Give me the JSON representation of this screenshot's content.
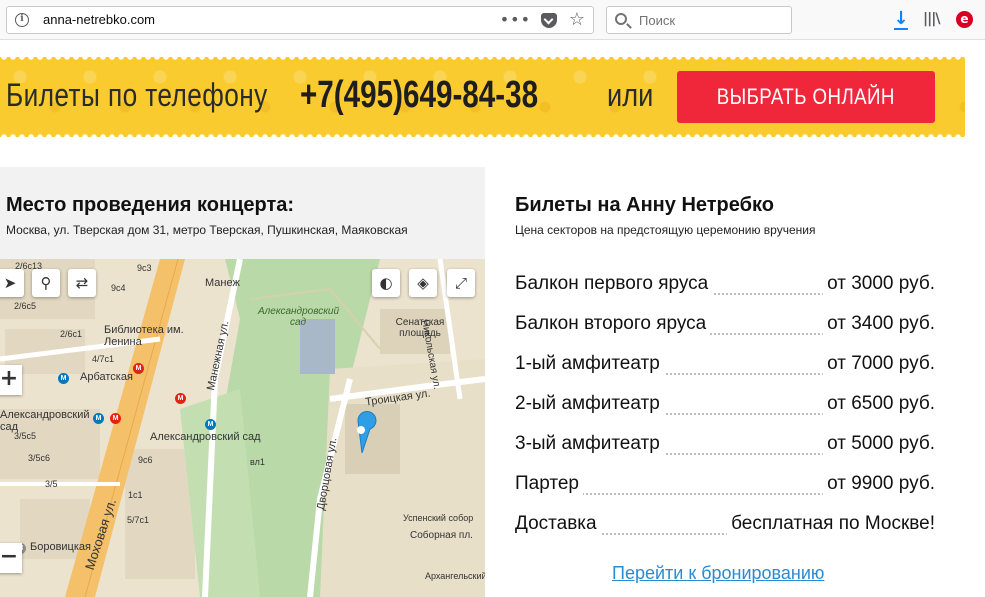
{
  "browser": {
    "url": "anna-netrebko.com",
    "search_placeholder": "Поиск"
  },
  "banner": {
    "phone_label": "Билеты по телефону",
    "phone_number": "+7(495)649-84-38",
    "or": "или",
    "cta": "ВЫБРАТЬ ОНЛАЙН"
  },
  "venue": {
    "title": "Место проведения концерта:",
    "address": "Москва, ул. Тверская дом 31, метро Тверская, Пушкинская, Маяковская",
    "map_labels": {
      "manezh": "Манеж",
      "alexandrovsky_garden_top": "Александровский сад",
      "senate_square": "Сенатская площадь",
      "nikolskaya": "Никольская ул.",
      "library": "Библиотека им. Ленина",
      "arbatskaya": "Арбатская",
      "alexandrovsky_garden_metro": "Александровский сад",
      "alexandrovsky_garden_left": "Александровский сад",
      "troitskaya": "Троицкая ул.",
      "manezhnaya": "Манежная ул.",
      "dvortsovaya": "Дворцовая ул.",
      "mokhovaya": "Моховая ул.",
      "borovitskaya": "Боровицкая",
      "uspensky": "Успенский собор",
      "sobornaya": "Соборная пл.",
      "arkhangelsky": "Архангельский",
      "b1": "2/6c13",
      "b2": "9c3",
      "b3": "2/6c5",
      "b4": "9c4",
      "b5": "2/6c1",
      "b6": "4/7c1",
      "b7": "3/5c5",
      "b8": "3/5c6",
      "b9": "3/5",
      "b10": "9c6",
      "b11": "вл1",
      "b12": "1c1",
      "b13": "5/7c1"
    }
  },
  "tickets": {
    "title": "Билеты на Анну Нетребко",
    "subtitle": "Цена секторов на предстоящую церемонию вручения",
    "rows": [
      {
        "name": "Балкон первого яруса",
        "price": "от 3000 руб."
      },
      {
        "name": "Балкон второго яруса",
        "price": "от 3400 руб."
      },
      {
        "name": "1-ый амфитеатр",
        "price": "от 7000 руб."
      },
      {
        "name": "2-ый амфитеатр",
        "price": "от 6500 руб."
      },
      {
        "name": "3-ый амфитеатр",
        "price": "от 5000 руб."
      },
      {
        "name": "Партер",
        "price": "от 9900 руб."
      },
      {
        "name": "Доставка",
        "price": "бесплатная по Москве!"
      }
    ],
    "booking_link": "Перейти к бронированию"
  }
}
